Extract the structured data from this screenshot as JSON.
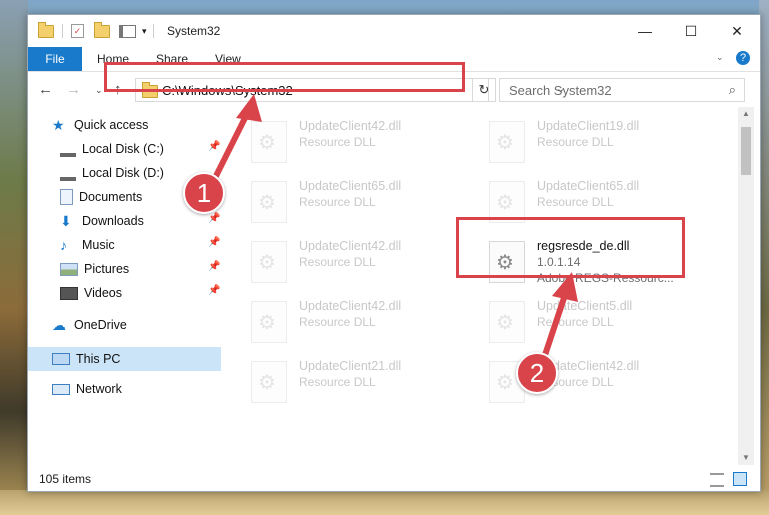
{
  "window": {
    "title": "System32",
    "controls": {
      "minimize": "—",
      "maximize": "☐",
      "close": "✕"
    }
  },
  "ribbon": {
    "file_tab": "File",
    "tabs": [
      "Home",
      "Share",
      "View"
    ],
    "help_icon": "?"
  },
  "address": {
    "path": "C:\\Windows\\System32",
    "search_placeholder": "Search System32"
  },
  "sidebar": {
    "quick_access": "Quick access",
    "items": [
      {
        "label": "Local Disk (C:)",
        "icon": "drive-icon"
      },
      {
        "label": "Local Disk (D:)",
        "icon": "drive-icon"
      },
      {
        "label": "Documents",
        "icon": "documents-icon"
      },
      {
        "label": "Downloads",
        "icon": "downloads-icon"
      },
      {
        "label": "Music",
        "icon": "music-icon"
      },
      {
        "label": "Pictures",
        "icon": "pictures-icon"
      },
      {
        "label": "Videos",
        "icon": "videos-icon"
      }
    ],
    "onedrive": "OneDrive",
    "this_pc": "This PC",
    "network": "Network"
  },
  "files": {
    "faded": [
      {
        "name": "UpdateClient42.dll",
        "type": "Resource DLL"
      },
      {
        "name": "UpdateClient19.dll",
        "type": "Resource DLL"
      },
      {
        "name": "UpdateClient65.dll",
        "type": "Resource DLL"
      },
      {
        "name": "UpdateClient65.dll",
        "type": "Resource DLL"
      },
      {
        "name": "UpdateClient42.dll",
        "type": "Resource DLL"
      },
      {
        "name": "UpdateClient42.dll",
        "type": "Resource DLL"
      },
      {
        "name": "UpdateClient5.dll",
        "type": "Resource DLL"
      },
      {
        "name": "UpdateClient21.dll",
        "type": "Resource DLL"
      },
      {
        "name": "UpdateClient42.dll",
        "type": "Resource DLL"
      }
    ],
    "main": {
      "name": "regsresde_de.dll",
      "version": "1.0.1.14",
      "description": "Adobe REGS-Ressourc..."
    }
  },
  "status": {
    "items": "105 items"
  },
  "annotations": {
    "step1": "1",
    "step2": "2",
    "accent": "#d9444b"
  }
}
